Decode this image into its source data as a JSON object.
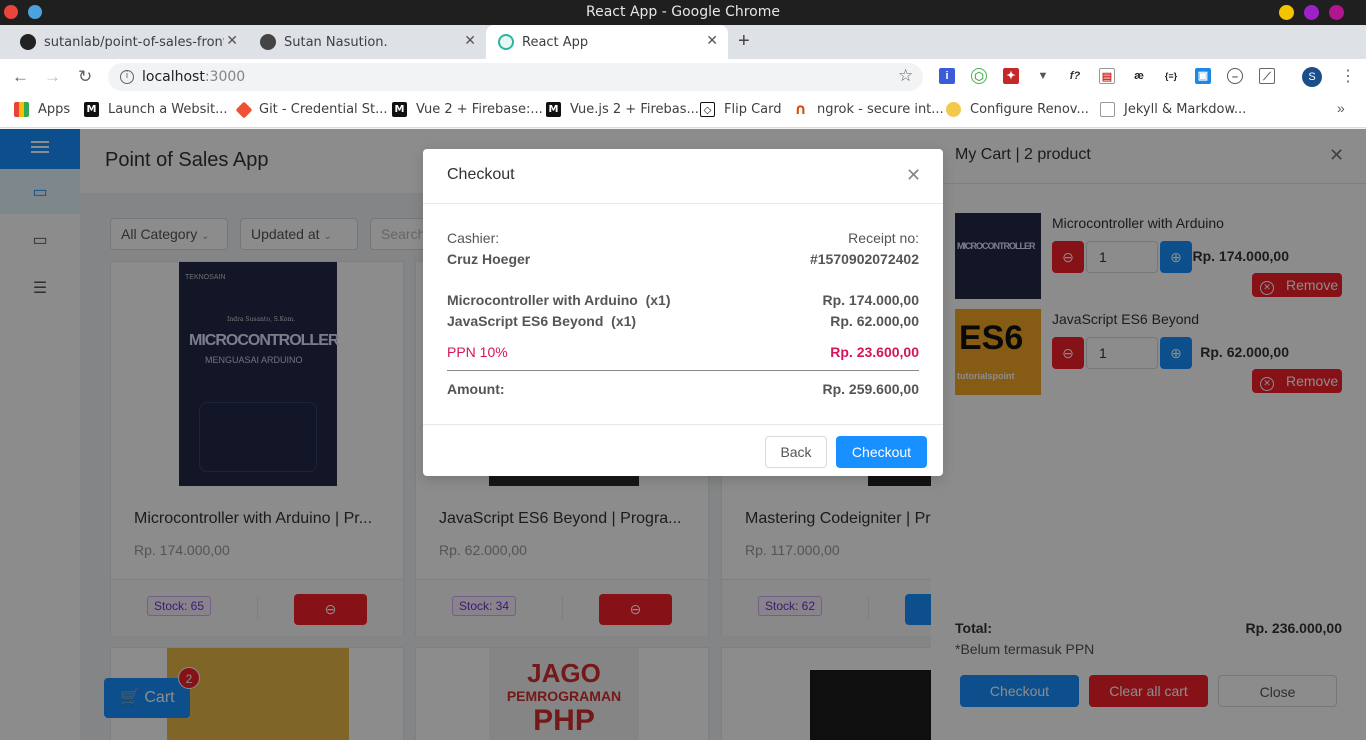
{
  "window": {
    "title": "React App - Google Chrome"
  },
  "tabs": [
    {
      "label": "sutanlab/point-of-sales-fronte"
    },
    {
      "label": "Sutan Nasution."
    },
    {
      "label": "React App"
    }
  ],
  "address": {
    "host": "localhost",
    "port": ":3000"
  },
  "bookmarks": [
    {
      "label": "Apps"
    },
    {
      "label": "Launch a Websit..."
    },
    {
      "label": "Git - Credential St..."
    },
    {
      "label": "Vue 2 + Firebase:..."
    },
    {
      "label": "Vue.js 2 + Firebas..."
    },
    {
      "label": "Flip Card"
    },
    {
      "label": "ngrok - secure int..."
    },
    {
      "label": "Configure Renov..."
    },
    {
      "label": "Jekyll & Markdow..."
    }
  ],
  "profile": {
    "initial": "S"
  },
  "app": {
    "title": "Point of Sales App",
    "filters": {
      "category": "All Category",
      "sort": "Updated at",
      "search_placeholder": "Search"
    },
    "products": [
      {
        "name": "Microcontroller with Arduino | Pr...",
        "price": "Rp. 174.000,00",
        "stock": "Stock: 65"
      },
      {
        "name": "JavaScript ES6 Beyond | Progra...",
        "price": "Rp. 62.000,00",
        "stock": "Stock: 34"
      },
      {
        "name": "Mastering Codeigniter | Pr",
        "price": "Rp. 117.000,00",
        "stock": "Stock: 62"
      }
    ],
    "cart_button": {
      "label": "Cart",
      "count": "2"
    }
  },
  "drawer": {
    "title": "My Cart | 2 product",
    "items": [
      {
        "name": "Microcontroller with Arduino",
        "qty": "1",
        "price": "Rp. 174.000,00",
        "remove": "Remove"
      },
      {
        "name": "JavaScript ES6 Beyond",
        "qty": "1",
        "price": "Rp. 62.000,00",
        "remove": "Remove"
      }
    ],
    "total_label": "Total:",
    "total_value": "Rp. 236.000,00",
    "note": "*Belum termasuk PPN",
    "checkout": "Checkout",
    "clear": "Clear all cart",
    "close": "Close"
  },
  "modal": {
    "title": "Checkout",
    "cashier_label": "Cashier:",
    "cashier_name": "Cruz Hoeger",
    "receipt_label": "Receipt no:",
    "receipt_no": "#1570902072402",
    "lines": [
      {
        "item": "Microcontroller with Arduino  (x1)",
        "price": "Rp. 174.000,00"
      },
      {
        "item": "JavaScript ES6 Beyond  (x1)",
        "price": "Rp. 62.000,00"
      }
    ],
    "tax_label": "PPN 10%",
    "tax_value": "Rp. 23.600,00",
    "amount_label": "Amount:",
    "amount_value": "Rp. 259.600,00",
    "back": "Back",
    "checkout": "Checkout"
  },
  "colors": {
    "primary": "#1890ff",
    "danger": "#f5222d",
    "stock_tag": "#722ed1"
  },
  "book_art": {
    "micro_publisher": "TEKNOSAIN",
    "micro_author": "Indra Susanto, S.Kom.",
    "micro_title": "MICROCONTROLLER",
    "micro_subtitle": "MENGUASAI ARDUINO",
    "es6_title": "ES6",
    "es6_brand": "tutorialspoint",
    "php_title": "JAGO",
    "php_subtitle": "PEMROGRAMAN",
    "php_word": "PHP"
  }
}
